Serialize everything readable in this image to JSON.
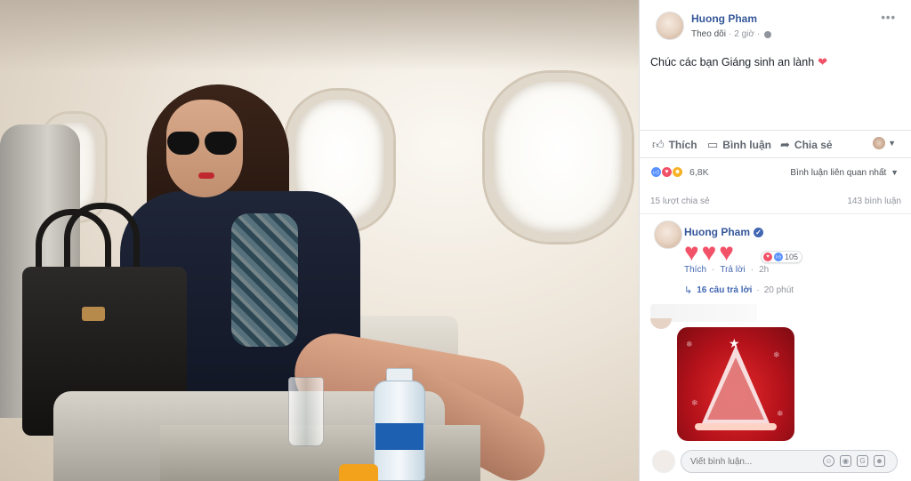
{
  "post": {
    "author": "Huong Pham",
    "follow_label": "Theo dõi",
    "separator": "·",
    "time": "2 giờ",
    "text": "Chúc các bạn Giáng sinh an lành",
    "heart_emoji": "❤",
    "more": "•••"
  },
  "actions": {
    "like": "Thích",
    "comment": "Bình luận",
    "share": "Chia sẻ",
    "like_icon": "thumbs-up-icon",
    "comment_icon": "speech-bubble-icon",
    "share_icon": "share-arrow-icon"
  },
  "reactions": {
    "count": "6,8K",
    "types": [
      "like",
      "love",
      "haha"
    ],
    "sort_label": "Bình luận liên quan nhất"
  },
  "stats": {
    "shares": "15 lượt chia sẻ",
    "comments": "143 bình luận"
  },
  "comments": [
    {
      "author": "Huong Pham",
      "verified": true,
      "content_hearts": 3,
      "reaction_count": "105",
      "like_label": "Thích",
      "reply_label": "Trả lời",
      "separator": "·",
      "time": "2h",
      "replies": "16 câu trả lời",
      "replies_separator": "·",
      "replies_time": "20 phút"
    }
  ],
  "composer": {
    "placeholder": "Viết bình luận..."
  },
  "colors": {
    "link_blue": "#365899",
    "heart_red": "#f25268",
    "like_blue": "#5890ff",
    "haha_yellow": "#f7b125"
  }
}
